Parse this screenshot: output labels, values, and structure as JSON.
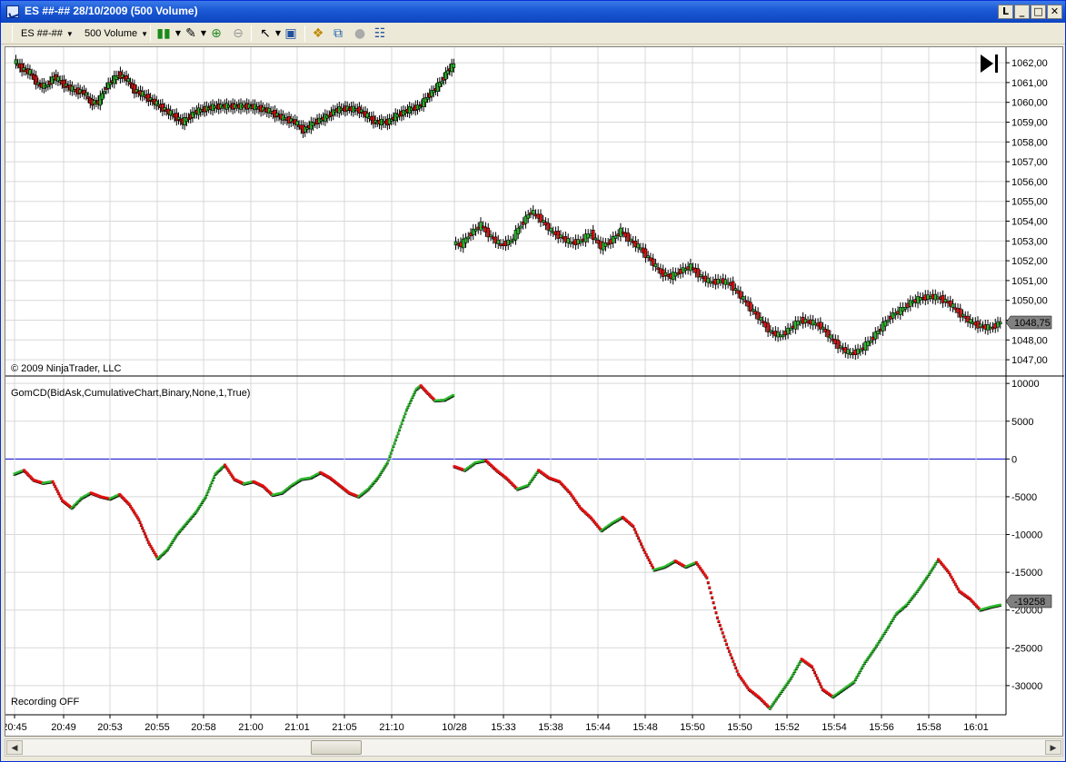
{
  "window": {
    "title": "ES ##-## 28/10/2009 (500 Volume)",
    "controls": {
      "minimize": "_",
      "maximize": "□",
      "close": "✕",
      "restore": "L"
    }
  },
  "toolbar": {
    "instrument": "ES ##-##",
    "period": "500 Volume",
    "icons": [
      "candlestick-icon",
      "pencil-icon",
      "zoom-in-icon",
      "zoom-out-icon",
      "cursor-icon",
      "properties-icon",
      "strategy-icon",
      "indicator-icon",
      "circle-icon",
      "data-box-icon"
    ]
  },
  "price_panel": {
    "copyright": "© 2009 NinjaTrader, LLC",
    "last_price": "1048,75",
    "y_ticks": [
      "1062,00",
      "1061,00",
      "1060,00",
      "1059,00",
      "1058,00",
      "1057,00",
      "1056,00",
      "1055,00",
      "1054,00",
      "1053,00",
      "1052,00",
      "1051,00",
      "1050,00",
      "1049,00",
      "1048,00",
      "1047,00"
    ]
  },
  "indicator_panel": {
    "label": "GomCD(BidAsk,CumulativeChart,Binary,None,1,True)",
    "recording": "Recording OFF",
    "last_value": "-19258",
    "y_ticks": [
      "10000",
      "5000",
      "0",
      "-5000",
      "-10000",
      "-15000",
      "-20000",
      "-25000",
      "-30000"
    ]
  },
  "x_ticks": [
    "20:45",
    "20:49",
    "20:53",
    "20:55",
    "20:58",
    "21:00",
    "21:01",
    "21:05",
    "21:10",
    "10/28",
    "15:33",
    "15:38",
    "15:44",
    "15:48",
    "15:50",
    "15:50",
    "15:52",
    "15:54",
    "15:56",
    "15:58",
    "16:01"
  ],
  "colors": {
    "up": "#2eb82e",
    "down": "#e01010",
    "zero_line": "#0000cc"
  },
  "chart_data": [
    {
      "type": "candlestick",
      "title": "",
      "ylim": [
        1046.5,
        1062.6
      ],
      "series": [
        {
          "segment": 1,
          "points": [
            [
              0,
              1062.1
            ],
            [
              4,
              1061.7
            ],
            [
              8,
              1061.5
            ],
            [
              12,
              1060.9
            ],
            [
              16,
              1060.8
            ],
            [
              20,
              1061.3
            ],
            [
              25,
              1060.9
            ],
            [
              30,
              1060.6
            ],
            [
              35,
              1060.5
            ],
            [
              38,
              1060.0
            ],
            [
              42,
              1060.0
            ],
            [
              46,
              1060.8
            ],
            [
              52,
              1061.4
            ],
            [
              56,
              1061.2
            ],
            [
              60,
              1060.6
            ],
            [
              64,
              1060.4
            ],
            [
              70,
              1060.0
            ],
            [
              74,
              1059.7
            ],
            [
              80,
              1059.3
            ],
            [
              84,
              1059.0
            ],
            [
              90,
              1059.5
            ],
            [
              96,
              1059.7
            ],
            [
              102,
              1059.8
            ],
            [
              110,
              1059.8
            ],
            [
              118,
              1059.8
            ],
            [
              126,
              1059.6
            ],
            [
              134,
              1059.2
            ],
            [
              140,
              1059.0
            ],
            [
              144,
              1058.6
            ],
            [
              150,
              1059.0
            ],
            [
              156,
              1059.3
            ],
            [
              160,
              1059.6
            ],
            [
              166,
              1059.7
            ],
            [
              172,
              1059.6
            ],
            [
              176,
              1059.3
            ],
            [
              180,
              1059.0
            ],
            [
              186,
              1059.0
            ],
            [
              190,
              1059.3
            ],
            [
              196,
              1059.6
            ],
            [
              202,
              1059.8
            ],
            [
              206,
              1060.3
            ],
            [
              210,
              1060.7
            ],
            [
              213,
              1061.1
            ],
            [
              216,
              1061.6
            ],
            [
              219,
              1061.9
            ]
          ]
        },
        {
          "segment": 2,
          "points": [
            [
              221,
              1052.9
            ],
            [
              224,
              1052.8
            ],
            [
              228,
              1053.4
            ],
            [
              232,
              1053.8
            ],
            [
              236,
              1053.2
            ],
            [
              240,
              1052.8
            ],
            [
              244,
              1053.0
            ],
            [
              248,
              1053.8
            ],
            [
              252,
              1054.5
            ],
            [
              256,
              1054.1
            ],
            [
              260,
              1053.5
            ],
            [
              264,
              1053.2
            ],
            [
              268,
              1052.9
            ],
            [
              272,
              1053.0
            ],
            [
              276,
              1053.4
            ],
            [
              280,
              1052.7
            ],
            [
              284,
              1053.0
            ],
            [
              288,
              1053.5
            ],
            [
              292,
              1053.0
            ],
            [
              296,
              1052.6
            ],
            [
              300,
              1052.0
            ],
            [
              304,
              1051.4
            ],
            [
              308,
              1051.2
            ],
            [
              312,
              1051.5
            ],
            [
              316,
              1051.7
            ],
            [
              320,
              1051.2
            ],
            [
              324,
              1050.9
            ],
            [
              328,
              1051.0
            ],
            [
              332,
              1050.8
            ],
            [
              336,
              1050.2
            ],
            [
              340,
              1049.6
            ],
            [
              344,
              1049.0
            ],
            [
              348,
              1048.4
            ],
            [
              352,
              1048.2
            ],
            [
              356,
              1048.6
            ],
            [
              360,
              1049.0
            ],
            [
              364,
              1048.9
            ],
            [
              368,
              1048.7
            ],
            [
              372,
              1048.1
            ],
            [
              376,
              1047.6
            ],
            [
              380,
              1047.3
            ],
            [
              384,
              1047.5
            ],
            [
              388,
              1048.0
            ],
            [
              392,
              1048.6
            ],
            [
              396,
              1049.2
            ],
            [
              400,
              1049.5
            ],
            [
              404,
              1049.9
            ],
            [
              408,
              1050.1
            ],
            [
              412,
              1050.2
            ],
            [
              416,
              1050.1
            ],
            [
              420,
              1049.8
            ],
            [
              424,
              1049.3
            ],
            [
              428,
              1048.9
            ],
            [
              432,
              1048.7
            ],
            [
              436,
              1048.6
            ],
            [
              440,
              1048.9
            ]
          ]
        }
      ]
    },
    {
      "type": "line",
      "title": "",
      "ylim": [
        -33500,
        10500
      ],
      "series": [
        {
          "segment": 1,
          "points": [
            [
              0,
              -2000
            ],
            [
              4,
              -1500
            ],
            [
              8,
              -2800
            ],
            [
              12,
              -3200
            ],
            [
              16,
              -3000
            ],
            [
              20,
              -5500
            ],
            [
              24,
              -6500
            ],
            [
              28,
              -5200
            ],
            [
              32,
              -4500
            ],
            [
              36,
              -5000
            ],
            [
              40,
              -5300
            ],
            [
              44,
              -4700
            ],
            [
              48,
              -6000
            ],
            [
              52,
              -8000
            ],
            [
              56,
              -11000
            ],
            [
              60,
              -13200
            ],
            [
              64,
              -12000
            ],
            [
              68,
              -10000
            ],
            [
              72,
              -8500
            ],
            [
              76,
              -7000
            ],
            [
              80,
              -5000
            ],
            [
              84,
              -2000
            ],
            [
              88,
              -800
            ],
            [
              92,
              -2700
            ],
            [
              96,
              -3300
            ],
            [
              100,
              -3000
            ],
            [
              104,
              -3600
            ],
            [
              108,
              -4800
            ],
            [
              112,
              -4500
            ],
            [
              116,
              -3500
            ],
            [
              120,
              -2700
            ],
            [
              124,
              -2500
            ],
            [
              128,
              -1800
            ],
            [
              132,
              -2500
            ],
            [
              136,
              -3500
            ],
            [
              140,
              -4500
            ],
            [
              144,
              -5000
            ],
            [
              148,
              -4000
            ],
            [
              152,
              -2500
            ],
            [
              156,
              -500
            ],
            [
              160,
              3000
            ],
            [
              164,
              6500
            ],
            [
              168,
              9200
            ],
            [
              170,
              9700
            ],
            [
              172,
              9000
            ],
            [
              176,
              7700
            ],
            [
              180,
              7800
            ],
            [
              184,
              8500
            ]
          ]
        },
        {
          "segment": 2,
          "points": [
            [
              190,
              -1000
            ],
            [
              194,
              -1500
            ],
            [
              198,
              -500
            ],
            [
              202,
              -200
            ],
            [
              206,
              -1500
            ],
            [
              210,
              -2600
            ],
            [
              214,
              -4000
            ],
            [
              218,
              -3500
            ],
            [
              222,
              -1500
            ],
            [
              226,
              -2500
            ],
            [
              230,
              -3000
            ],
            [
              234,
              -4500
            ],
            [
              238,
              -6500
            ],
            [
              242,
              -7800
            ],
            [
              246,
              -9500
            ],
            [
              250,
              -8500
            ],
            [
              254,
              -7700
            ],
            [
              258,
              -8900
            ],
            [
              262,
              -12000
            ],
            [
              266,
              -14700
            ],
            [
              270,
              -14300
            ],
            [
              274,
              -13500
            ],
            [
              278,
              -14300
            ],
            [
              282,
              -13700
            ],
            [
              286,
              -15700
            ],
            [
              290,
              -21000
            ],
            [
              294,
              -25000
            ],
            [
              298,
              -28500
            ],
            [
              302,
              -30500
            ],
            [
              306,
              -31600
            ],
            [
              310,
              -33000
            ],
            [
              314,
              -31000
            ],
            [
              318,
              -29000
            ],
            [
              322,
              -26500
            ],
            [
              326,
              -27500
            ],
            [
              330,
              -30500
            ],
            [
              334,
              -31500
            ],
            [
              338,
              -30500
            ],
            [
              342,
              -29500
            ],
            [
              346,
              -27000
            ],
            [
              350,
              -25000
            ],
            [
              354,
              -22800
            ],
            [
              358,
              -20500
            ],
            [
              362,
              -19300
            ],
            [
              366,
              -17500
            ],
            [
              370,
              -15500
            ],
            [
              374,
              -13300
            ],
            [
              378,
              -15000
            ],
            [
              382,
              -17500
            ],
            [
              386,
              -18500
            ],
            [
              390,
              -20000
            ],
            [
              394,
              -19600
            ],
            [
              398,
              -19300
            ]
          ]
        }
      ]
    }
  ]
}
